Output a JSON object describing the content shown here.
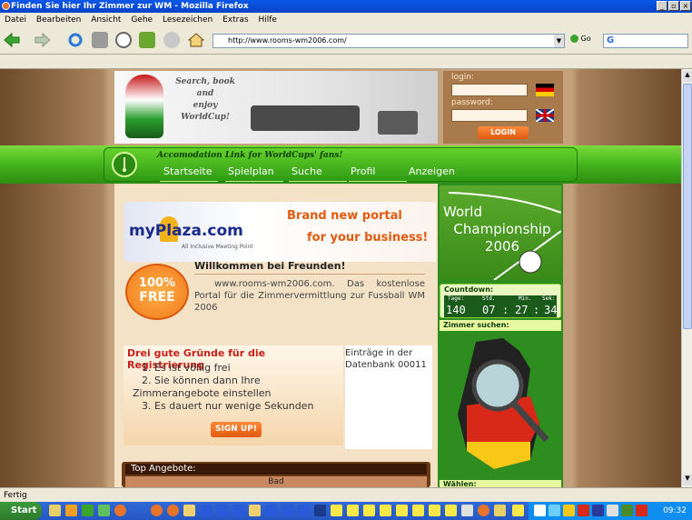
{
  "browser": {
    "title": "Finden Sie hier Ihr Zimmer zur WM - Mozilla Firefox",
    "menu": [
      "Datei",
      "Bearbeiten",
      "Ansicht",
      "Gehe",
      "Lesezeichen",
      "Extras",
      "Hilfe"
    ],
    "url": "http://www.rooms-wm2006.com/",
    "go_label": "Go",
    "status": "Fertig"
  },
  "taskbar": {
    "start_label": "Start",
    "clock": "09:32"
  },
  "header": {
    "slogan": [
      "Search, book",
      "and",
      "enjoy WorldCup!"
    ],
    "login_label": "login:",
    "password_label": "password:",
    "login_button": "LOGIN"
  },
  "nav": {
    "tagline": "Accomodation Link for WorldCups' fans!",
    "items": [
      "Startseite",
      "Spielplan",
      "Suche",
      "Profil",
      "Anzeigen"
    ]
  },
  "main": {
    "banner_logo": "myPlaza.com",
    "banner_logo_sub": "All Inclusive Meeting Point",
    "banner_headline1": "Brand new portal",
    "banner_headline2": "for your business!",
    "free_badge_top": "100%",
    "free_badge_bottom": "FREE",
    "welcome_title": "Willkommen bei Freunden!",
    "welcome_text": "www.rooms-wm2006.com. Das kostenlose Portal für die Zimmervermittlung zur Fussball WM 2006",
    "reasons_title": "Drei gute Gründe für die Registrierung",
    "reasons": [
      "1. Es ist völlig frei",
      "2. Sie können dann Ihre",
      "Zimmerangebote einstellen",
      "3. Es dauert nur wenige Sekunden"
    ],
    "signup_button": "SIGN UP!",
    "entries_text": "Einträge in der Datenbank 00011",
    "offers_title": "Top Angebote:",
    "offers_col": "Bad"
  },
  "sidebar": {
    "wc_title": [
      "World",
      "Championship",
      "2006"
    ],
    "countdown_label": "Countdown:",
    "countdown_units": [
      "Tage:",
      "Std.",
      "Min.",
      "Sek:"
    ],
    "countdown_values": [
      "140",
      "07",
      ":",
      "27",
      ":",
      "34"
    ],
    "search_label": "Zimmer suchen:",
    "waehlen_label": "Wählen:"
  }
}
